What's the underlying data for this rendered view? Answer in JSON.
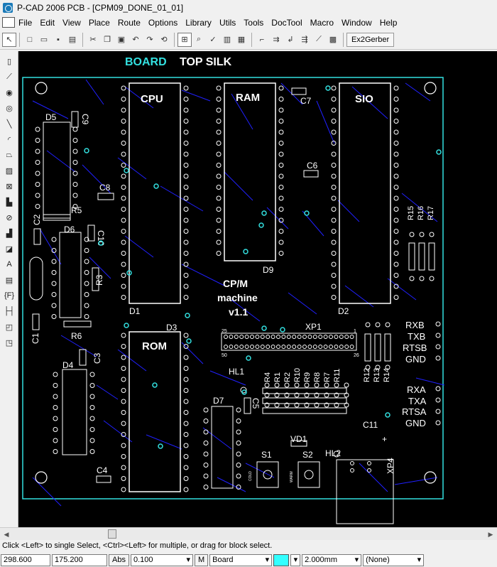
{
  "window": {
    "title": "P-CAD 2006 PCB - [CPM09_DONE_01_01]"
  },
  "menu": [
    "File",
    "Edit",
    "View",
    "Place",
    "Route",
    "Options",
    "Library",
    "Utils",
    "Tools",
    "DocTool",
    "Macro",
    "Window",
    "Help"
  ],
  "toolbar": {
    "ex2gerber_label": "Ex2Gerber"
  },
  "canvas": {
    "layer_label_board": "BOARD",
    "layer_label_top_silk": "TOP SILK",
    "chip_cpu": "CPU",
    "chip_ram": "RAM",
    "chip_sio": "SIO",
    "chip_rom": "ROM",
    "desc_line1": "CP/M",
    "desc_line2": "machine",
    "desc_line3": "v1.1",
    "conn_xp1": "XP1",
    "conn_xp4": "XP4",
    "xp1_pin1": "1",
    "xp1_pin25": "25",
    "xp1_pin26": "26",
    "xp1_pin50": "50",
    "refs": {
      "d1": "D1",
      "d2": "D2",
      "d3": "D3",
      "d4": "D4",
      "d5": "D5",
      "d6": "D6",
      "d7": "D7",
      "d9": "D9",
      "c1": "C1",
      "c2": "C2",
      "c3": "C3",
      "c4": "C4",
      "c5": "C5",
      "c6": "C6",
      "c7": "C7",
      "c8": "C8",
      "c9": "C9",
      "c10": "C10",
      "c11": "C11",
      "r1": "R1",
      "r2": "R2",
      "r3": "R3",
      "r4": "R4",
      "r5": "R5",
      "r6": "R6",
      "r7": "R7",
      "r8": "R8",
      "r9": "R9",
      "r10": "R10",
      "r11": "R11",
      "r12": "R12",
      "r13": "R13",
      "r14": "R14",
      "r15": "R15",
      "r16": "R16",
      "r17": "R17",
      "hl1": "HL1",
      "hl2": "HL2",
      "vd1": "VD1",
      "s1": "S1",
      "s2": "S2",
      "s1_sub": "COLD",
      "s2_sub": "WARM",
      "c11_plus": "+"
    },
    "port_labels": {
      "rxb": "RXB",
      "txb": "TXB",
      "rtsb": "RTSB",
      "gnd1": "GND",
      "rxa": "RXA",
      "txa": "TXA",
      "rtsa": "RTSA",
      "gnd2": "GND"
    },
    "colors": {
      "board_outline": "#33e0e0",
      "silk": "#ffffff",
      "trace": "#2020ff",
      "via": "#33e0e0",
      "background": "#000000"
    }
  },
  "status": {
    "message": "Click <Left> to single Select, <Ctrl><Left> for multiple, or drag for block select.",
    "x_coord": "298.600",
    "y_coord": "175.200",
    "abs_button": "Abs",
    "grid_value": "0.100",
    "m_button": "M",
    "layer_value": "Board",
    "layer_color": "#33ffff",
    "width_value": "2.000mm",
    "style_value": "(None)"
  }
}
